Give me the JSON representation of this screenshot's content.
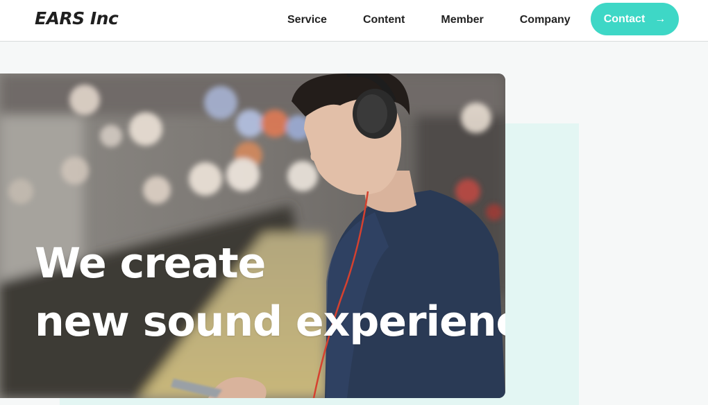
{
  "header": {
    "logo": "EARS Inc",
    "nav": [
      {
        "label": "Service"
      },
      {
        "label": "Content"
      },
      {
        "label": "Member"
      },
      {
        "label": "Company"
      }
    ],
    "contact": {
      "label": "Contact",
      "icon": "arrow-right-icon"
    }
  },
  "hero": {
    "line1": "We create",
    "line2": "new sound experience."
  },
  "colors": {
    "accent": "#3ed7c6",
    "mint": "#e3f6f3",
    "background": "#f6f8f8"
  }
}
